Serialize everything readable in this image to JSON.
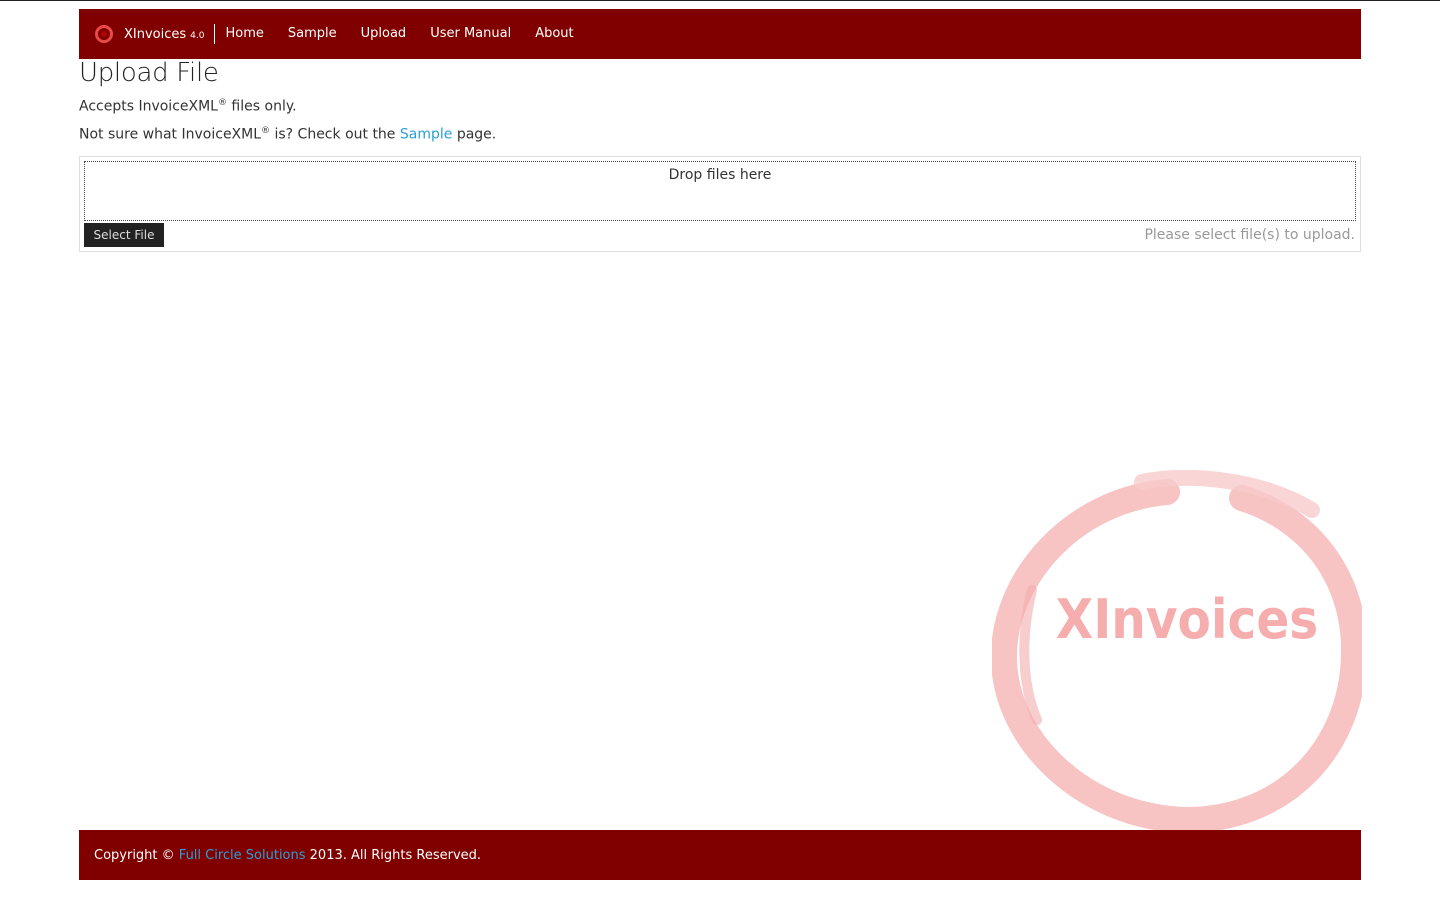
{
  "brand": {
    "name": "XInvoices",
    "version": "4.0"
  },
  "nav": {
    "items": [
      {
        "label": "Home"
      },
      {
        "label": "Sample"
      },
      {
        "label": "Upload"
      },
      {
        "label": "User Manual"
      },
      {
        "label": "About"
      }
    ]
  },
  "page": {
    "title": "Upload File",
    "accepts_prefix": "Accepts InvoiceXML",
    "registered_mark": "®",
    "accepts_suffix": " files only.",
    "notsure_prefix": "Not sure what InvoiceXML",
    "notsure_middle": " is? Check out the ",
    "sample_link": "Sample",
    "notsure_suffix": " page."
  },
  "upload": {
    "dropzone_label": "Drop files here",
    "select_button": "Select File",
    "status": "Please select file(s) to upload."
  },
  "watermark": {
    "text": "XInvoices"
  },
  "footer": {
    "prefix": "Copyright © ",
    "company_link": "Full Circle Solutions",
    "suffix": " 2013. All Rights Reserved."
  },
  "colors": {
    "brand": "#800000",
    "link": "#2a9fd6",
    "watermark": "#f6b9b9"
  }
}
